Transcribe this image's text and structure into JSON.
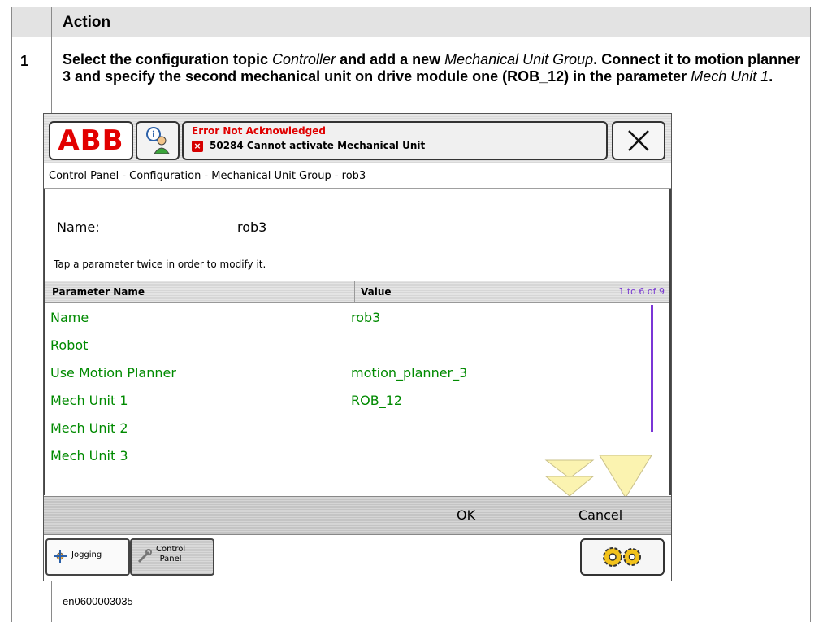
{
  "table": {
    "header": "Action",
    "step": "1",
    "instruction": {
      "t1": "Select the configuration topic ",
      "i1": "Controller",
      "t2": " and add a new ",
      "i2": "Mechanical Unit Group",
      "t3": ". Connect it to motion planner 3 and specify the second mechanical unit on drive module one (ROB_12) in the parameter ",
      "i3": "Mech Unit 1",
      "t4": "."
    },
    "caption": "en0600003035"
  },
  "pendant": {
    "logo": "ABB",
    "status_title": "Error Not Acknowledged",
    "status_message": "50284 Cannot activate Mechanical Unit",
    "breadcrumb": "Control Panel - Configuration - Mechanical Unit Group - rob3",
    "name_label": "Name:",
    "name_value": "rob3",
    "hint": "Tap a parameter twice in order to modify it.",
    "columns": {
      "name": "Parameter Name",
      "value": "Value",
      "range": "1 to 6 of 9"
    },
    "params": [
      {
        "name": "Name",
        "value": "rob3"
      },
      {
        "name": "Robot",
        "value": ""
      },
      {
        "name": "Use Motion Planner",
        "value": "motion_planner_3"
      },
      {
        "name": "Mech Unit 1",
        "value": "ROB_12"
      },
      {
        "name": "Mech Unit 2",
        "value": ""
      },
      {
        "name": "Mech Unit 3",
        "value": ""
      }
    ],
    "ok_label": "OK",
    "cancel_label": "Cancel",
    "tasks": {
      "jogging": "Jogging",
      "control_panel_1": "Control",
      "control_panel_2": "Panel"
    },
    "colors": {
      "logo_red": "#e20000",
      "param_green": "#008a00",
      "scroll_purple": "#7a35d6",
      "error_red": "#e00000"
    },
    "icons": [
      "abb-logo",
      "user-info-icon",
      "error-icon",
      "close-icon",
      "scroll-down-icon",
      "jogging-icon",
      "control-panel-icon",
      "quickset-gears-icon"
    ]
  }
}
